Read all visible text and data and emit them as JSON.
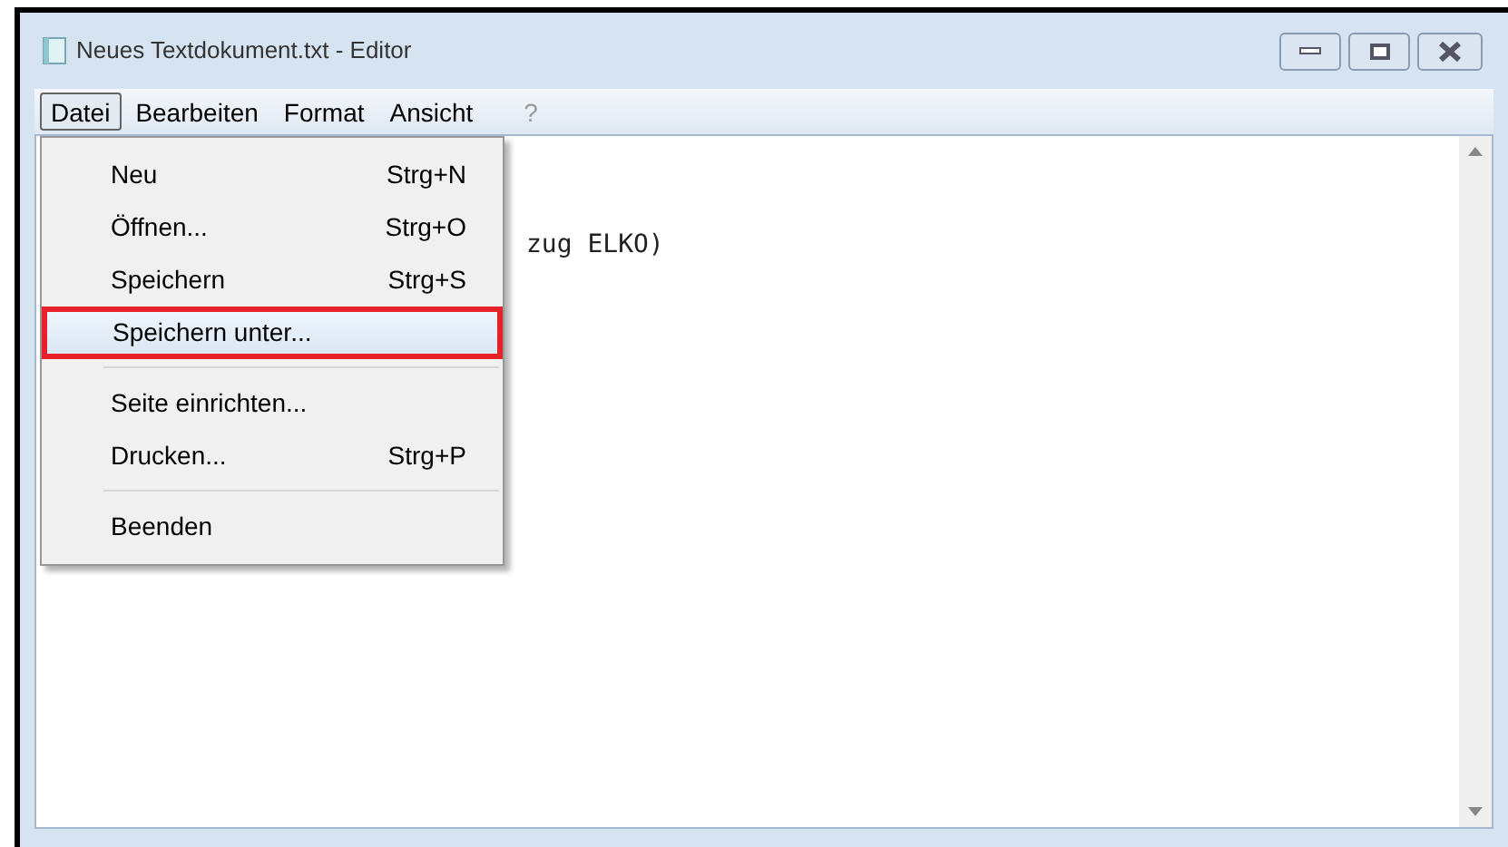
{
  "window": {
    "title": "Neues Textdokument.txt - Editor"
  },
  "menu_bar": [
    {
      "label": "Datei",
      "selected": true,
      "dimmed": false
    },
    {
      "label": "Bearbeiten",
      "selected": false,
      "dimmed": false
    },
    {
      "label": "Format",
      "selected": false,
      "dimmed": false
    },
    {
      "label": "Ansicht",
      "selected": false,
      "dimmed": false
    },
    {
      "label": "?",
      "selected": false,
      "dimmed": true
    }
  ],
  "editor": {
    "lines": [
      "zug ELKO)"
    ]
  },
  "file_menu": [
    {
      "kind": "item",
      "label": "Neu",
      "shortcut": "Strg+N",
      "selected": false,
      "outlined": false
    },
    {
      "kind": "item",
      "label": "Öffnen...",
      "shortcut": "Strg+O",
      "selected": false,
      "outlined": false
    },
    {
      "kind": "item",
      "label": "Speichern",
      "shortcut": "Strg+S",
      "selected": false,
      "outlined": false
    },
    {
      "kind": "item",
      "label": "Speichern unter...",
      "selected": true,
      "outlined": true
    },
    {
      "kind": "separator"
    },
    {
      "kind": "item",
      "label": "Seite einrichten...",
      "selected": false,
      "outlined": false
    },
    {
      "kind": "item",
      "label": "Drucken...",
      "shortcut": "Strg+P",
      "selected": false,
      "outlined": false
    },
    {
      "kind": "separator"
    },
    {
      "kind": "item",
      "label": "Beenden",
      "selected": false,
      "outlined": false
    }
  ]
}
